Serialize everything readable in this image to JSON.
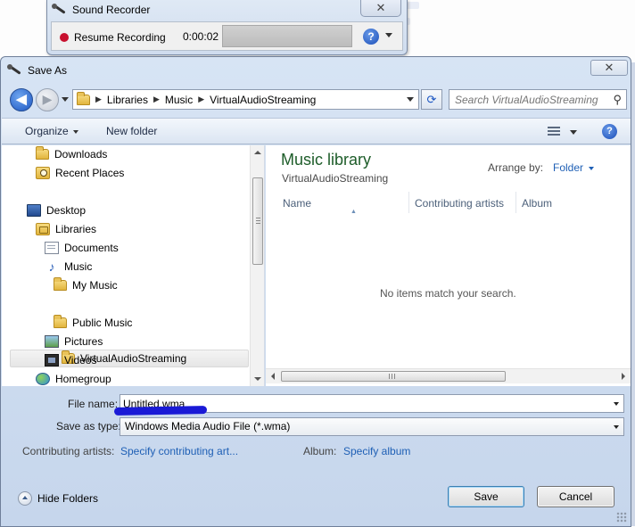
{
  "recorder": {
    "title": "Sound Recorder",
    "close_label": "✕",
    "resume_label": "Resume Recording",
    "elapsed": "0:00:02",
    "help_label": "?"
  },
  "dialog": {
    "title": "Save As",
    "close_label": "✕"
  },
  "address": {
    "crumbs": [
      "Libraries",
      "Music",
      "VirtualAudioStreaming"
    ],
    "sep": "▶",
    "refresh_label": "⟳"
  },
  "search": {
    "placeholder": "Search VirtualAudioStreaming"
  },
  "toolbar": {
    "organize_label": "Organize",
    "new_folder_label": "New folder",
    "help_label": "?"
  },
  "nav": {
    "items": [
      {
        "label": "Downloads",
        "icon": "folder-icon"
      },
      {
        "label": "Recent Places",
        "icon": "recent-places-icon"
      },
      {
        "label": "Desktop",
        "icon": "desktop-icon"
      },
      {
        "label": "Libraries",
        "icon": "libraries-icon"
      },
      {
        "label": "Documents",
        "icon": "documents-icon"
      },
      {
        "label": "Music",
        "icon": "music-icon"
      },
      {
        "label": "My Music",
        "icon": "folder-icon"
      },
      {
        "label": "VirtualAudioStreaming",
        "icon": "folder-icon"
      },
      {
        "label": "Public Music",
        "icon": "folder-icon"
      },
      {
        "label": "Pictures",
        "icon": "pictures-icon"
      },
      {
        "label": "Videos",
        "icon": "videos-icon"
      },
      {
        "label": "Homegroup",
        "icon": "homegroup-icon"
      }
    ],
    "selected": "VirtualAudioStreaming"
  },
  "content": {
    "title": "Music library",
    "subtitle": "VirtualAudioStreaming",
    "arrange_label": "Arrange by:",
    "arrange_value": "Folder",
    "columns": [
      "Name",
      "Contributing artists",
      "Album"
    ],
    "empty_message": "No items match your search."
  },
  "form": {
    "file_name_label": "File name:",
    "file_name_value": "Untitled.wma",
    "save_type_label": "Save as type:",
    "save_type_value": "Windows Media Audio File (*.wma)",
    "artists_label": "Contributing artists:",
    "artists_link": "Specify contributing art...",
    "album_label": "Album:",
    "album_link": "Specify album"
  },
  "footer": {
    "hide_folders_label": "Hide Folders",
    "save_label": "Save",
    "cancel_label": "Cancel"
  },
  "colors": {
    "accent_link": "#1e5fb5",
    "library_title": "#1e5d2a",
    "record_dot": "#c8102e",
    "annotation_scribble": "#1a1ad6"
  }
}
